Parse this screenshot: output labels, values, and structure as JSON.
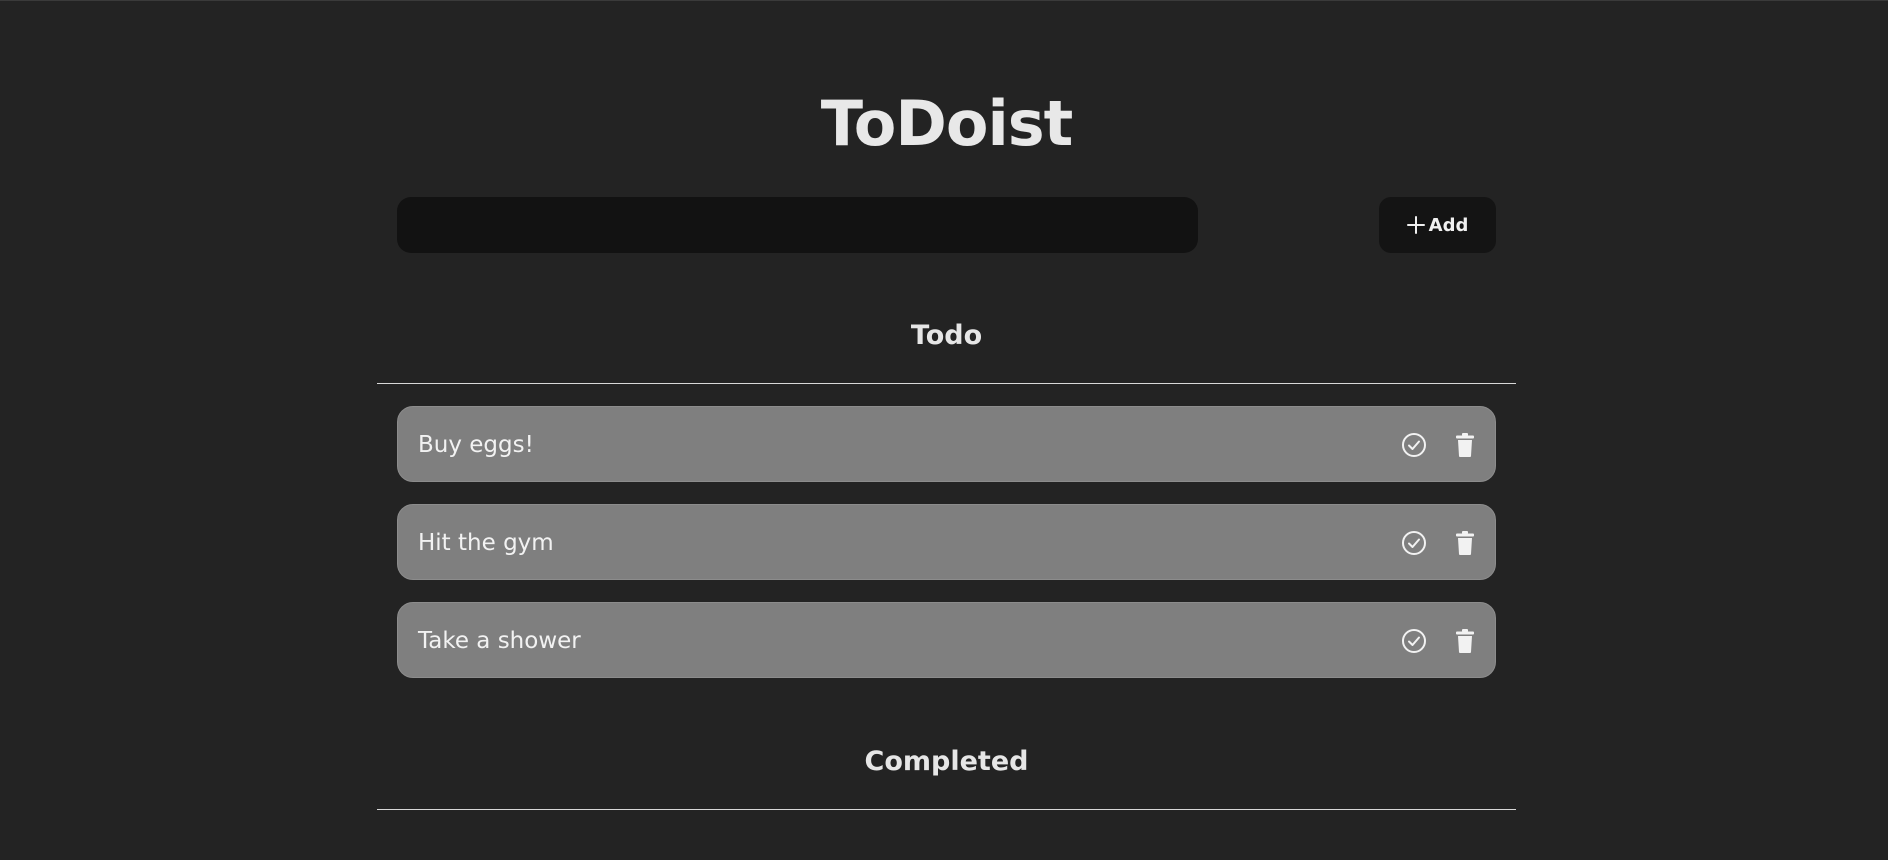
{
  "app": {
    "title": "ToDoist"
  },
  "new_task": {
    "value": "",
    "placeholder": "",
    "add_label": "Add",
    "add_icon": "plus-icon"
  },
  "sections": {
    "todo": {
      "heading": "Todo",
      "items": [
        {
          "text": "Buy eggs!",
          "complete_icon": "check-circle-icon",
          "delete_icon": "trash-icon"
        },
        {
          "text": "Hit the gym",
          "complete_icon": "check-circle-icon",
          "delete_icon": "trash-icon"
        },
        {
          "text": "Take a shower",
          "complete_icon": "check-circle-icon",
          "delete_icon": "trash-icon"
        }
      ]
    },
    "completed": {
      "heading": "Completed",
      "items": []
    }
  },
  "colors": {
    "background": "#232323",
    "input_background": "#121212",
    "button_background": "#141414",
    "item_background": "#7f7f7f",
    "text": "#e6e6e6",
    "divider": "#d8d8d8"
  }
}
